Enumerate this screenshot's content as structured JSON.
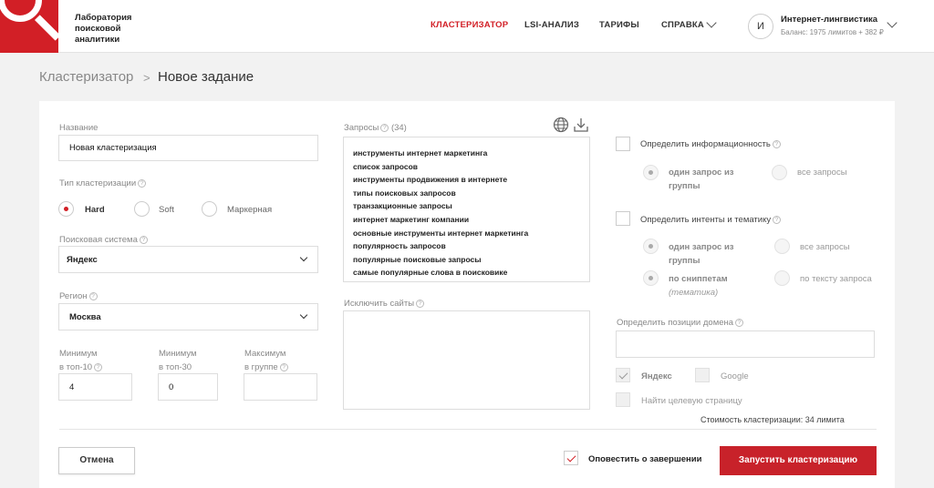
{
  "header": {
    "logo_text": "Лаборатория поисковой аналитики",
    "nav": {
      "clusterizer": "КЛАСТЕРИЗАТОР",
      "lsi": "LSI-АНАЛИЗ",
      "tariffs": "ТАРИФЫ",
      "help": "СПРАВКА"
    },
    "account": {
      "avatar_letter": "И",
      "name": "Интернет-лингвистика",
      "balance": "Баланс: 1975 лимитов + 382 ₽"
    }
  },
  "breadcrumb": {
    "root": "Кластеризатор",
    "separator": ">",
    "current": "Новое задание"
  },
  "form": {
    "name": {
      "label": "Название",
      "value": "Новая кластеризация"
    },
    "type": {
      "label": "Тип кластеризации",
      "options": [
        "Hard",
        "Soft",
        "Маркерная"
      ],
      "selected": "Hard"
    },
    "search_engine": {
      "label": "Поисковая система",
      "value": "Яндекс"
    },
    "region": {
      "label": "Регион",
      "value": "Москва"
    },
    "min_top10": {
      "label_line1": "Минимум",
      "label_line2": "в топ-10",
      "value": "4"
    },
    "min_top30": {
      "label_line1": "Минимум",
      "label_line2": "в топ-30",
      "value": "0"
    },
    "max_group": {
      "label_line1": "Максимум",
      "label_line2": "в группе",
      "value": ""
    },
    "queries": {
      "label": "Запросы",
      "count": "(34)",
      "items": [
        "инструменты интернет маркетинга",
        "список запросов",
        "инструменты продвижения в интернете",
        "типы поисковых запросов",
        "транзакционные запросы",
        "интернет маркетинг компании",
        "основные инструменты интернет маркетинга",
        "популярность запросов",
        "популярные поисковые запросы",
        "самые популярные слова в поисковике"
      ]
    },
    "exclude_sites": {
      "label": "Исключить сайты",
      "value": ""
    },
    "info": {
      "label": "Определить информационность",
      "opt_one_line1": "один запрос из",
      "opt_one_line2": "группы",
      "opt_all": "все запросы"
    },
    "intents": {
      "label": "Определить интенты и тематику",
      "opt_one_line1": "один запрос из",
      "opt_one_line2": "группы",
      "opt_all": "все запросы",
      "opt_snippets": "по сниппетам",
      "opt_snippets_sub": "(тематика)",
      "opt_query_text": "по тексту запроса"
    },
    "domain_positions": {
      "label": "Определить позиции домена",
      "value": ""
    },
    "engines": {
      "yandex": "Яндекс",
      "google": "Google"
    },
    "target_page": "Найти целевую страницу",
    "cost": "Стоимость кластеризации: 34 лимита"
  },
  "footer": {
    "cancel": "Отмена",
    "notify": "Оповестить о завершении",
    "run": "Запустить кластеризацию"
  },
  "colors": {
    "accent": "#d21f26",
    "button": "#c8222a"
  }
}
